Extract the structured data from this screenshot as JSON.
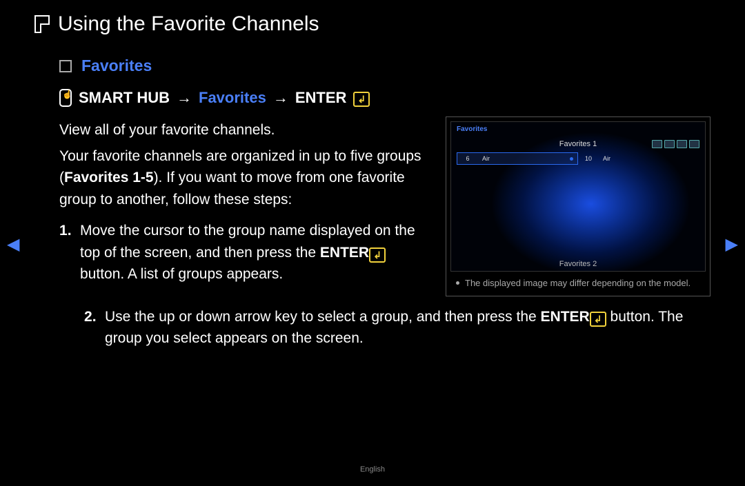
{
  "page": {
    "title": "Using the Favorite Channels",
    "subheading": "Favorites",
    "nav": {
      "hub": "SMART HUB",
      "favorites": "Favorites",
      "enter": "ENTER",
      "arrow": "→"
    },
    "intro_line": "View all of your favorite channels.",
    "intro_para_a": "Your favorite channels are organized in up to five groups (",
    "intro_para_strong": "Favorites 1-5",
    "intro_para_b": "). If you want to move from one favorite group to another, follow these steps:",
    "steps": {
      "s1a": "Move the cursor to the group name displayed on the top of the screen, and then press the ",
      "s1_enter": "ENTER",
      "s1b": " button. A list of groups appears.",
      "s2a": "Use the up or down arrow key to select a group, and then press the ",
      "s2_enter": "ENTER",
      "s2b": " button. The group you select appears on the screen."
    },
    "screenshot": {
      "title": "Favorites",
      "group": "Favorites 1",
      "ch1_num": "6",
      "ch1_name": "Air",
      "ch2_num": "10",
      "ch2_name": "Air",
      "bottom": "Favorites 2"
    },
    "caption": "The displayed image may differ depending on the model.",
    "footer": "English"
  }
}
